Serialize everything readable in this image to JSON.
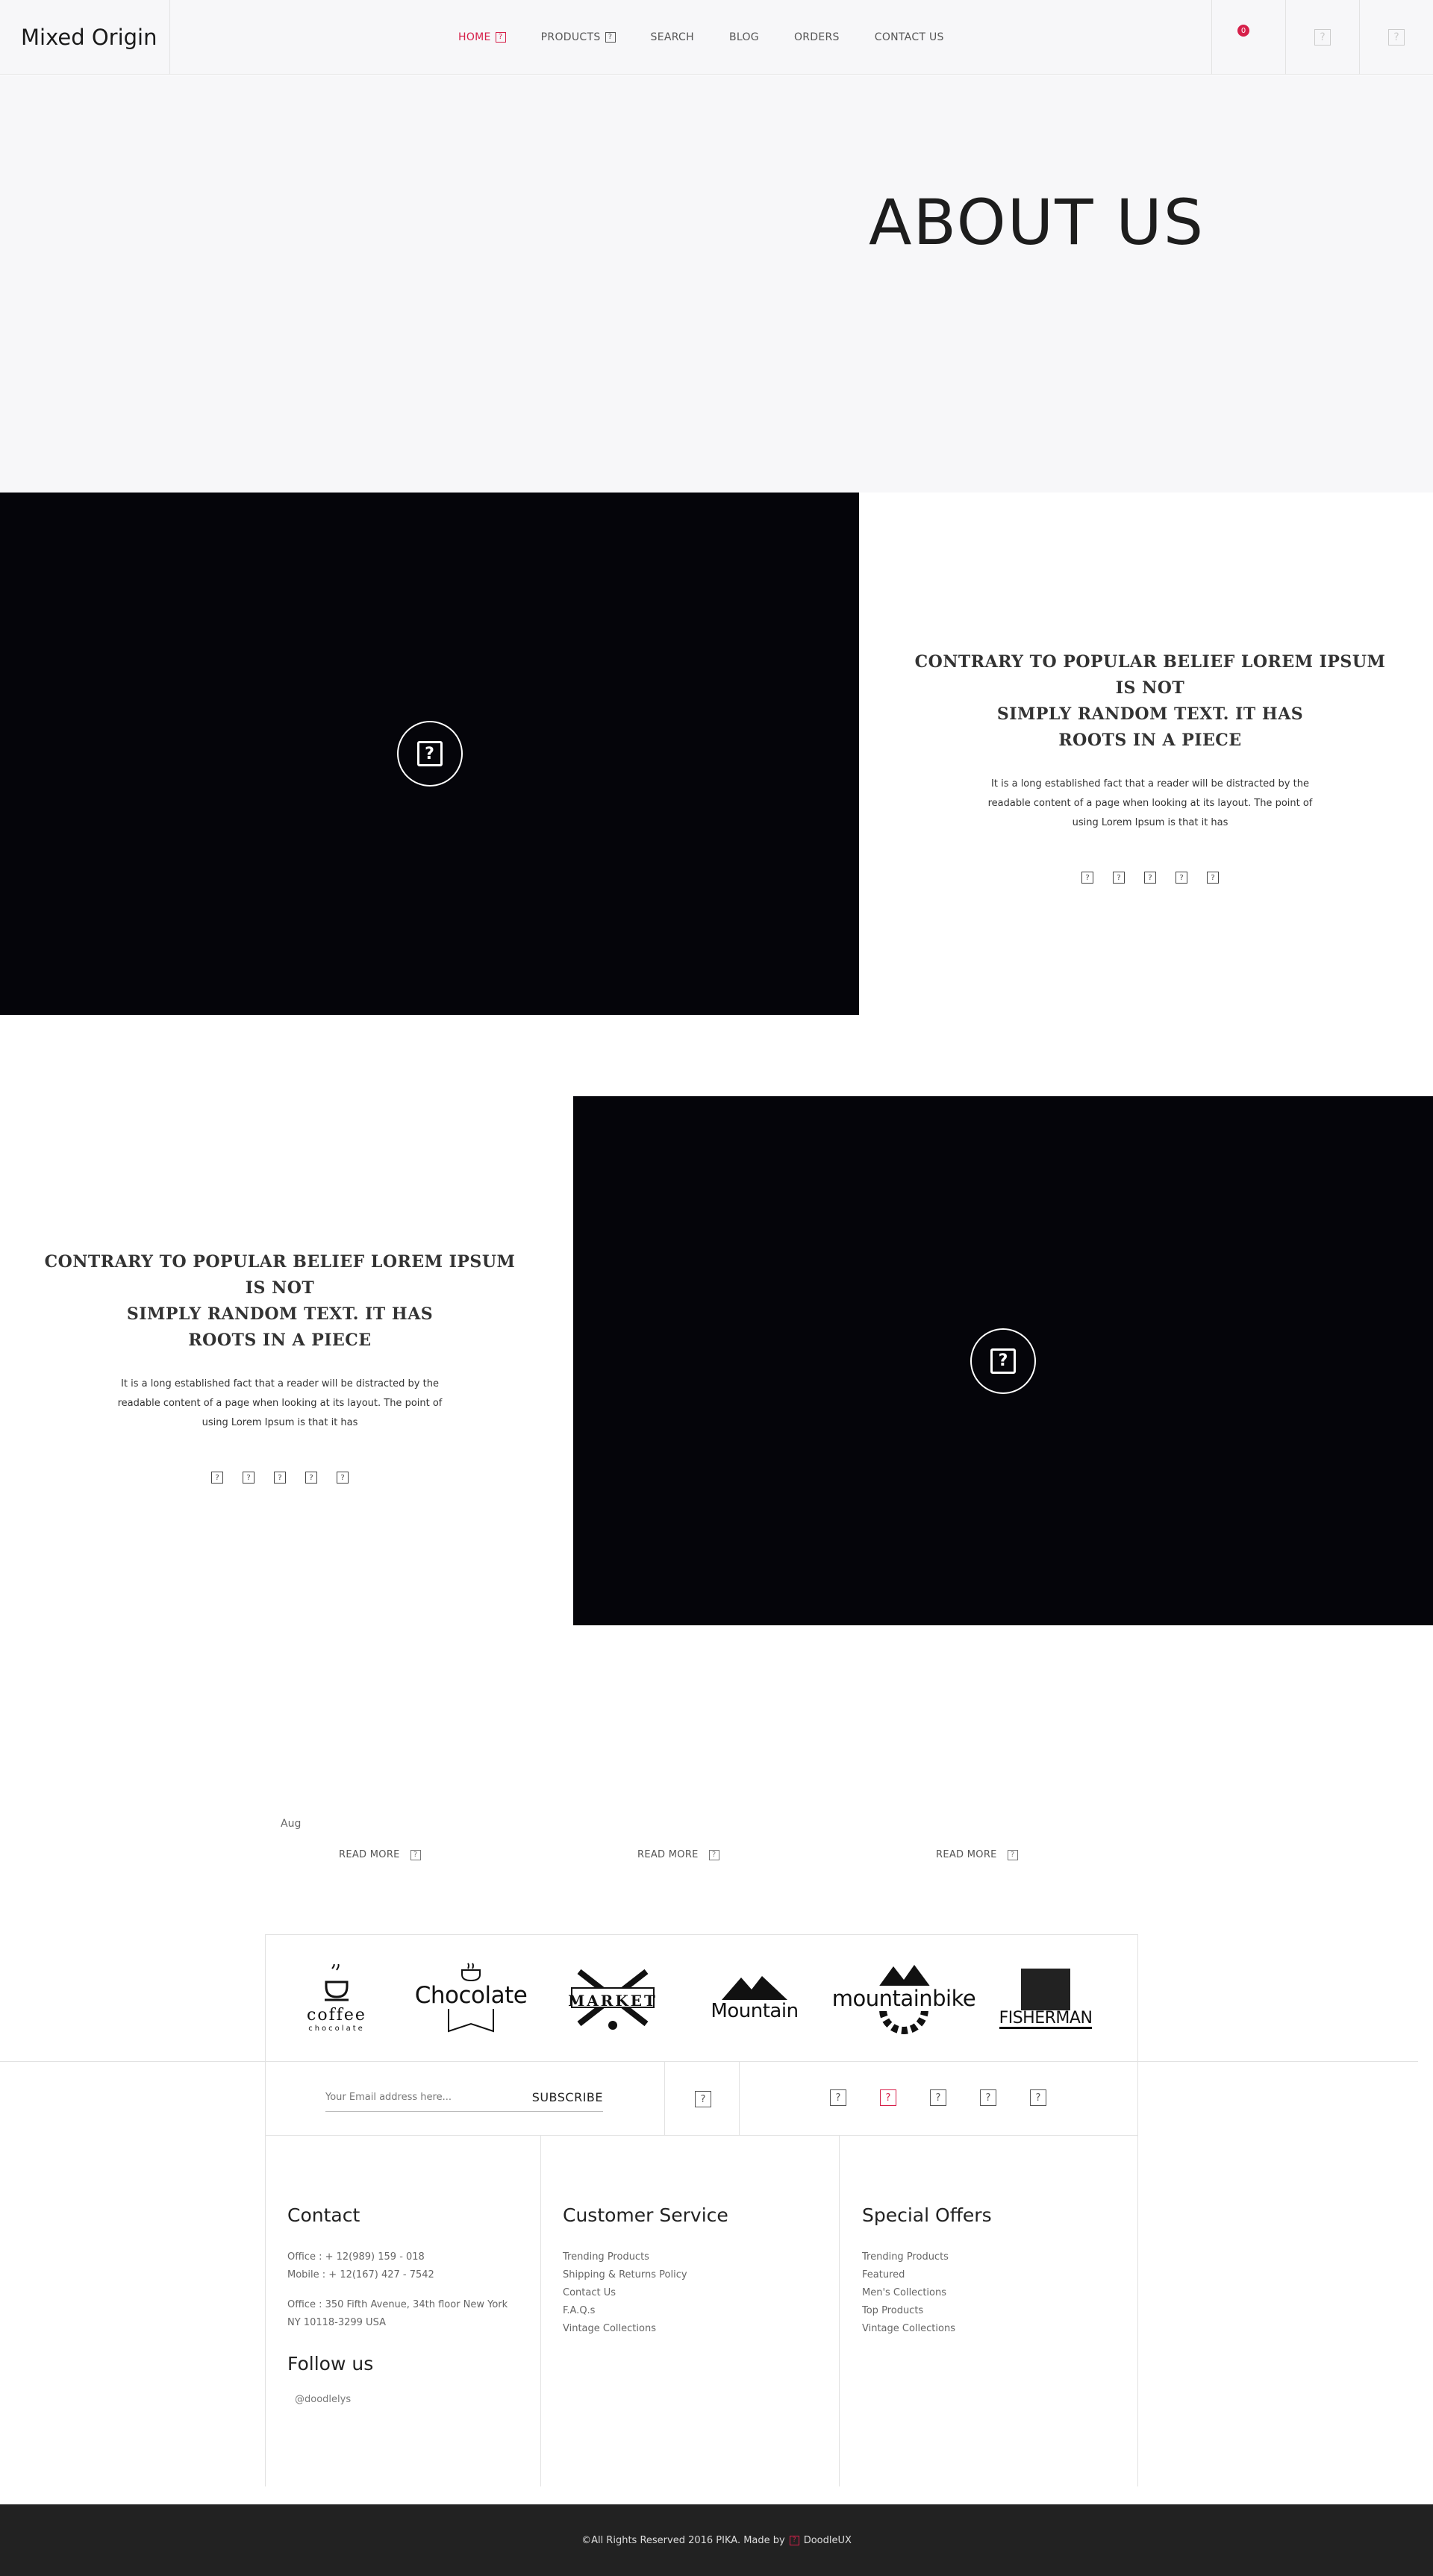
{
  "header": {
    "logo": "Mixed Origin",
    "nav": [
      {
        "label": "HOME"
      },
      {
        "label": "PRODUCTS"
      },
      {
        "label": "SEARCH"
      },
      {
        "label": "BLOG"
      },
      {
        "label": "ORDERS"
      },
      {
        "label": "CONTACT US"
      }
    ],
    "cart_count": "0",
    "icons": [
      "cart-icon",
      "user-icon",
      "menu-icon"
    ]
  },
  "hero": {
    "title": "ABOUT US"
  },
  "features": [
    {
      "heading_l1": "CONTRARY TO POPULAR BELIEF LOREM IPSUM IS NOT",
      "heading_l2": "SIMPLY RANDOM TEXT. IT HAS",
      "heading_l3": "ROOTS IN A PIECE",
      "body": "It is a long established fact that a reader will be distracted by the readable content of a page when looking at its layout. The point of using Lorem Ipsum is that it has"
    },
    {
      "heading_l1": "CONTRARY TO POPULAR BELIEF LOREM IPSUM IS NOT",
      "heading_l2": "SIMPLY RANDOM TEXT. IT HAS",
      "heading_l3": "ROOTS IN A PIECE",
      "body": "It is a long established fact that a reader will be distracted by the readable content of a page when looking at its layout. The point of using Lorem Ipsum is that it has"
    }
  ],
  "blog": {
    "date": "Aug",
    "read_more": "READ MORE"
  },
  "brands": {
    "coffee": "coffee",
    "coffee_sub": "chocolate",
    "chocolate": "Chocolate",
    "market": "MARKET",
    "mountain": "Mountain",
    "mountainbike": "mountainbike",
    "fisherman": "FISHERMAN"
  },
  "subscribe": {
    "placeholder": "Your Email address here...",
    "button": "SUBSCRIBE"
  },
  "footer": {
    "contact": {
      "title": "Contact",
      "office_phone": "Office : + 12(989) 159 - 018",
      "mobile": "Mobile : + 12(167) 427 - 7542",
      "address_l1": "Office : 350 Fifth Avenue, 34th floor New York",
      "address_l2": "NY 10118-3299 USA",
      "follow_title": "Follow us",
      "handle": "@doodlelys"
    },
    "customer_service": {
      "title": "Customer Service",
      "links": [
        "Trending Products",
        "Shipping & Returns Policy",
        "Contact Us",
        "F.A.Q.s",
        "Vintage Collections"
      ]
    },
    "special_offers": {
      "title": "Special Offers",
      "links": [
        "Trending Products",
        "Featured",
        "Men's Collections",
        "Top Products",
        "Vintage Collections"
      ]
    }
  },
  "copyright": {
    "text": "©All Rights Reserved 2016 PIKA. Made by",
    "brand": "DoodleUX"
  },
  "colors": {
    "accent": "#d6204a",
    "dark": "#05050a",
    "footer_bg": "#222222"
  }
}
